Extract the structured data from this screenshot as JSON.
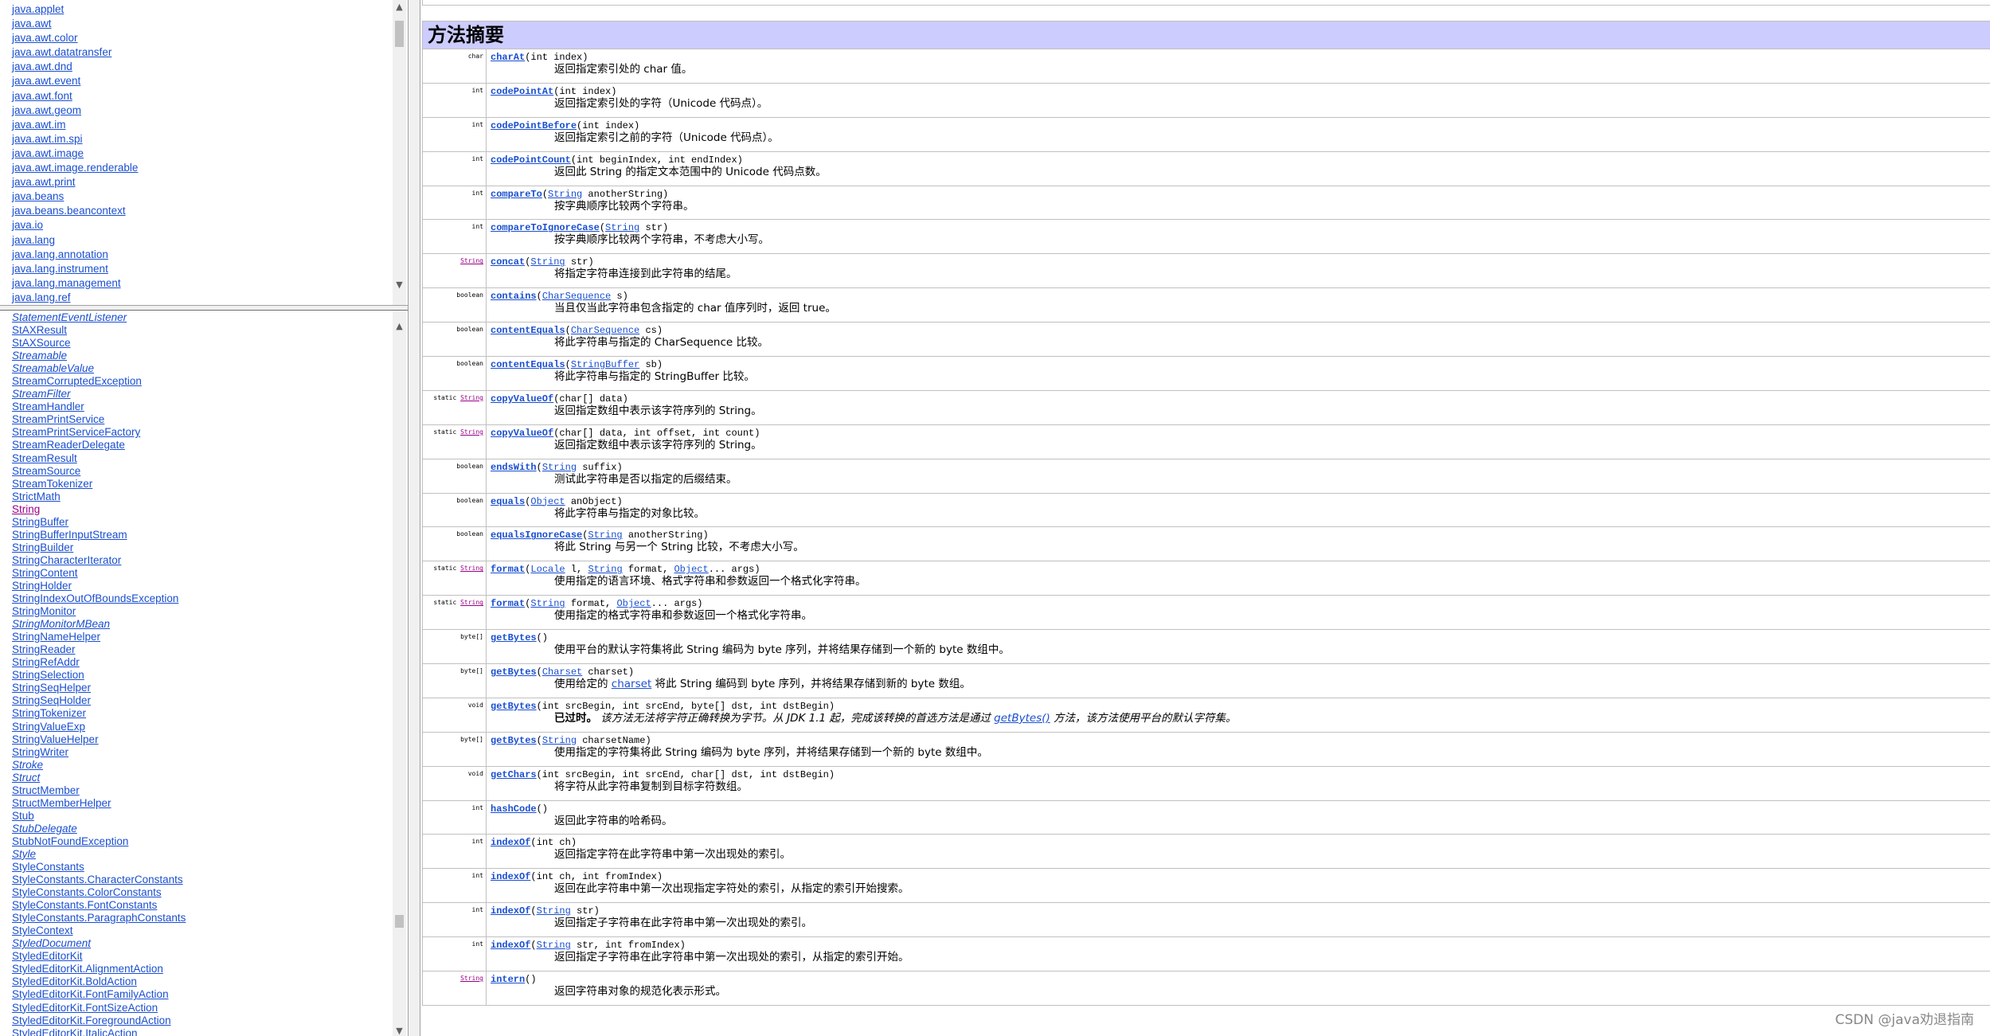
{
  "packages": [
    "java.applet",
    "java.awt",
    "java.awt.color",
    "java.awt.datatransfer",
    "java.awt.dnd",
    "java.awt.event",
    "java.awt.font",
    "java.awt.geom",
    "java.awt.im",
    "java.awt.im.spi",
    "java.awt.image",
    "java.awt.image.renderable",
    "java.awt.print",
    "java.beans",
    "java.beans.beancontext",
    "java.io",
    "java.lang",
    "java.lang.annotation",
    "java.lang.instrument",
    "java.lang.management",
    "java.lang.ref"
  ],
  "classes": [
    {
      "name": "StatementEventListener",
      "interface": true
    },
    {
      "name": "StAXResult"
    },
    {
      "name": "StAXSource"
    },
    {
      "name": "Streamable",
      "interface": true
    },
    {
      "name": "StreamableValue",
      "interface": true
    },
    {
      "name": "StreamCorruptedException"
    },
    {
      "name": "StreamFilter",
      "interface": true
    },
    {
      "name": "StreamHandler"
    },
    {
      "name": "StreamPrintService"
    },
    {
      "name": "StreamPrintServiceFactory"
    },
    {
      "name": "StreamReaderDelegate"
    },
    {
      "name": "StreamResult"
    },
    {
      "name": "StreamSource"
    },
    {
      "name": "StreamTokenizer"
    },
    {
      "name": "StrictMath"
    },
    {
      "name": "String",
      "current": true
    },
    {
      "name": "StringBuffer"
    },
    {
      "name": "StringBufferInputStream"
    },
    {
      "name": "StringBuilder"
    },
    {
      "name": "StringCharacterIterator"
    },
    {
      "name": "StringContent"
    },
    {
      "name": "StringHolder"
    },
    {
      "name": "StringIndexOutOfBoundsException"
    },
    {
      "name": "StringMonitor"
    },
    {
      "name": "StringMonitorMBean",
      "interface": true
    },
    {
      "name": "StringNameHelper"
    },
    {
      "name": "StringReader"
    },
    {
      "name": "StringRefAddr"
    },
    {
      "name": "StringSelection"
    },
    {
      "name": "StringSeqHelper"
    },
    {
      "name": "StringSeqHolder"
    },
    {
      "name": "StringTokenizer"
    },
    {
      "name": "StringValueExp"
    },
    {
      "name": "StringValueHelper"
    },
    {
      "name": "StringWriter"
    },
    {
      "name": "Stroke",
      "interface": true
    },
    {
      "name": "Struct",
      "interface": true
    },
    {
      "name": "StructMember"
    },
    {
      "name": "StructMemberHelper"
    },
    {
      "name": "Stub"
    },
    {
      "name": "StubDelegate",
      "interface": true
    },
    {
      "name": "StubNotFoundException"
    },
    {
      "name": "Style",
      "interface": true
    },
    {
      "name": "StyleConstants"
    },
    {
      "name": "StyleConstants.CharacterConstants"
    },
    {
      "name": "StyleConstants.ColorConstants"
    },
    {
      "name": "StyleConstants.FontConstants"
    },
    {
      "name": "StyleConstants.ParagraphConstants"
    },
    {
      "name": "StyleContext"
    },
    {
      "name": "StyledDocument",
      "interface": true
    },
    {
      "name": "StyledEditorKit"
    },
    {
      "name": "StyledEditorKit.AlignmentAction"
    },
    {
      "name": "StyledEditorKit.BoldAction"
    },
    {
      "name": "StyledEditorKit.FontFamilyAction"
    },
    {
      "name": "StyledEditorKit.FontSizeAction"
    },
    {
      "name": "StyledEditorKit.ForegroundAction"
    },
    {
      "name": "StyledEditorKit.ItalicAction"
    }
  ],
  "summary_title": "方法摘要",
  "methods": [
    {
      "mod": [
        {
          "t": "char"
        }
      ],
      "sig": [
        {
          "m": "charAt"
        },
        {
          "t": "(int index)"
        }
      ],
      "desc": [
        {
          "t": "返回指定索引处的 char 值。"
        }
      ]
    },
    {
      "mod": [
        {
          "t": "int"
        }
      ],
      "sig": [
        {
          "m": "codePointAt"
        },
        {
          "t": "(int index)"
        }
      ],
      "desc": [
        {
          "t": "返回指定索引处的字符（Unicode 代码点）。"
        }
      ]
    },
    {
      "mod": [
        {
          "t": "int"
        }
      ],
      "sig": [
        {
          "m": "codePointBefore"
        },
        {
          "t": "(int index)"
        }
      ],
      "desc": [
        {
          "t": "返回指定索引之前的字符（Unicode 代码点）。"
        }
      ]
    },
    {
      "mod": [
        {
          "t": "int"
        }
      ],
      "sig": [
        {
          "m": "codePointCount"
        },
        {
          "t": "(int beginIndex, int endIndex)"
        }
      ],
      "desc": [
        {
          "t": "返回此 String 的指定文本范围中的 Unicode 代码点数。"
        }
      ]
    },
    {
      "mod": [
        {
          "t": "int"
        }
      ],
      "sig": [
        {
          "m": "compareTo"
        },
        {
          "t": "("
        },
        {
          "l": "String"
        },
        {
          "t": " anotherString)"
        }
      ],
      "desc": [
        {
          "t": "按字典顺序比较两个字符串。"
        }
      ]
    },
    {
      "mod": [
        {
          "t": "int"
        }
      ],
      "sig": [
        {
          "m": "compareToIgnoreCase"
        },
        {
          "t": "("
        },
        {
          "l": "String"
        },
        {
          "t": " str)"
        }
      ],
      "desc": [
        {
          "t": "按字典顺序比较两个字符串，不考虑大小写。"
        }
      ]
    },
    {
      "mod": [
        {
          "l": "String"
        }
      ],
      "sig": [
        {
          "m": "concat"
        },
        {
          "t": "("
        },
        {
          "l": "String"
        },
        {
          "t": " str)"
        }
      ],
      "desc": [
        {
          "t": "将指定字符串连接到此字符串的结尾。"
        }
      ]
    },
    {
      "mod": [
        {
          "t": "boolean"
        }
      ],
      "sig": [
        {
          "m": "contains"
        },
        {
          "t": "("
        },
        {
          "l": "CharSequence"
        },
        {
          "t": " s)"
        }
      ],
      "desc": [
        {
          "t": "当且仅当此字符串包含指定的 char 值序列时，返回 true。"
        }
      ]
    },
    {
      "mod": [
        {
          "t": "boolean"
        }
      ],
      "sig": [
        {
          "m": "contentEquals"
        },
        {
          "t": "("
        },
        {
          "l": "CharSequence"
        },
        {
          "t": " cs)"
        }
      ],
      "desc": [
        {
          "t": "将此字符串与指定的 CharSequence 比较。"
        }
      ]
    },
    {
      "mod": [
        {
          "t": "boolean"
        }
      ],
      "sig": [
        {
          "m": "contentEquals"
        },
        {
          "t": "("
        },
        {
          "l": "StringBuffer"
        },
        {
          "t": " sb)"
        }
      ],
      "desc": [
        {
          "t": "将此字符串与指定的 StringBuffer 比较。"
        }
      ]
    },
    {
      "mod": [
        {
          "t": "static "
        },
        {
          "l": "String"
        }
      ],
      "sig": [
        {
          "m": "copyValueOf"
        },
        {
          "t": "(char[] data)"
        }
      ],
      "desc": [
        {
          "t": "返回指定数组中表示该字符序列的 String。"
        }
      ]
    },
    {
      "mod": [
        {
          "t": "static "
        },
        {
          "l": "String"
        }
      ],
      "sig": [
        {
          "m": "copyValueOf"
        },
        {
          "t": "(char[] data, int offset, int count)"
        }
      ],
      "desc": [
        {
          "t": "返回指定数组中表示该字符序列的 String。"
        }
      ]
    },
    {
      "mod": [
        {
          "t": "boolean"
        }
      ],
      "sig": [
        {
          "m": "endsWith"
        },
        {
          "t": "("
        },
        {
          "l": "String"
        },
        {
          "t": " suffix)"
        }
      ],
      "desc": [
        {
          "t": "测试此字符串是否以指定的后缀结束。"
        }
      ]
    },
    {
      "mod": [
        {
          "t": "boolean"
        }
      ],
      "sig": [
        {
          "m": "equals"
        },
        {
          "t": "("
        },
        {
          "l": "Object"
        },
        {
          "t": " anObject)"
        }
      ],
      "desc": [
        {
          "t": "将此字符串与指定的对象比较。"
        }
      ]
    },
    {
      "mod": [
        {
          "t": "boolean"
        }
      ],
      "sig": [
        {
          "m": "equalsIgnoreCase"
        },
        {
          "t": "("
        },
        {
          "l": "String"
        },
        {
          "t": " anotherString)"
        }
      ],
      "desc": [
        {
          "t": "将此 String 与另一个 String 比较，不考虑大小写。"
        }
      ]
    },
    {
      "mod": [
        {
          "t": "static "
        },
        {
          "l": "String"
        }
      ],
      "sig": [
        {
          "m": "format"
        },
        {
          "t": "("
        },
        {
          "l": "Locale"
        },
        {
          "t": " l, "
        },
        {
          "l": "String"
        },
        {
          "t": " format, "
        },
        {
          "l": "Object"
        },
        {
          "t": "... args)"
        }
      ],
      "desc": [
        {
          "t": "使用指定的语言环境、格式字符串和参数返回一个格式化字符串。"
        }
      ]
    },
    {
      "mod": [
        {
          "t": "static "
        },
        {
          "l": "String"
        }
      ],
      "sig": [
        {
          "m": "format"
        },
        {
          "t": "("
        },
        {
          "l": "String"
        },
        {
          "t": " format, "
        },
        {
          "l": "Object"
        },
        {
          "t": "... args)"
        }
      ],
      "desc": [
        {
          "t": "使用指定的格式字符串和参数返回一个格式化字符串。"
        }
      ]
    },
    {
      "mod": [
        {
          "t": "byte[]"
        }
      ],
      "sig": [
        {
          "m": "getBytes"
        },
        {
          "t": "()"
        }
      ],
      "desc": [
        {
          "t": "使用平台的默认字符集将此 String 编码为 byte 序列，并将结果存储到一个新的 byte 数组中。"
        }
      ]
    },
    {
      "mod": [
        {
          "t": "byte[]"
        }
      ],
      "sig": [
        {
          "m": "getBytes"
        },
        {
          "t": "("
        },
        {
          "l": "Charset"
        },
        {
          "t": " charset)"
        }
      ],
      "desc": [
        {
          "t": "使用给定的 "
        },
        {
          "l": "charset"
        },
        {
          "t": " 将此 String 编码到 byte 序列，并将结果存储到新的 byte 数组。"
        }
      ]
    },
    {
      "mod": [
        {
          "t": "void"
        }
      ],
      "sig": [
        {
          "m": "getBytes"
        },
        {
          "t": "(int srcBegin, int srcEnd, byte[] dst, int dstBegin)"
        }
      ],
      "desc": [
        {
          "b": "已过时。"
        },
        {
          "i": " 该方法无法将字符正确转换为字节。从 JDK 1.1 起，完成该转换的首选方法是通过 "
        },
        {
          "li": "getBytes()"
        },
        {
          "i": " 方法，该方法使用平台的默认字符集。"
        }
      ]
    },
    {
      "mod": [
        {
          "t": "byte[]"
        }
      ],
      "sig": [
        {
          "m": "getBytes"
        },
        {
          "t": "("
        },
        {
          "l": "String"
        },
        {
          "t": " charsetName)"
        }
      ],
      "desc": [
        {
          "t": "使用指定的字符集将此 String 编码为 byte 序列，并将结果存储到一个新的 byte 数组中。"
        }
      ]
    },
    {
      "mod": [
        {
          "t": "void"
        }
      ],
      "sig": [
        {
          "m": "getChars"
        },
        {
          "t": "(int srcBegin, int srcEnd, char[] dst, int dstBegin)"
        }
      ],
      "desc": [
        {
          "t": "将字符从此字符串复制到目标字符数组。"
        }
      ]
    },
    {
      "mod": [
        {
          "t": "int"
        }
      ],
      "sig": [
        {
          "m": "hashCode"
        },
        {
          "t": "()"
        }
      ],
      "desc": [
        {
          "t": "返回此字符串的哈希码。"
        }
      ]
    },
    {
      "mod": [
        {
          "t": "int"
        }
      ],
      "sig": [
        {
          "m": "indexOf"
        },
        {
          "t": "(int ch)"
        }
      ],
      "desc": [
        {
          "t": "返回指定字符在此字符串中第一次出现处的索引。"
        }
      ]
    },
    {
      "mod": [
        {
          "t": "int"
        }
      ],
      "sig": [
        {
          "m": "indexOf"
        },
        {
          "t": "(int ch, int fromIndex)"
        }
      ],
      "desc": [
        {
          "t": "返回在此字符串中第一次出现指定字符处的索引，从指定的索引开始搜索。"
        }
      ]
    },
    {
      "mod": [
        {
          "t": "int"
        }
      ],
      "sig": [
        {
          "m": "indexOf"
        },
        {
          "t": "("
        },
        {
          "l": "String"
        },
        {
          "t": " str)"
        }
      ],
      "desc": [
        {
          "t": "返回指定子字符串在此字符串中第一次出现处的索引。"
        }
      ]
    },
    {
      "mod": [
        {
          "t": "int"
        }
      ],
      "sig": [
        {
          "m": "indexOf"
        },
        {
          "t": "("
        },
        {
          "l": "String"
        },
        {
          "t": " str, int fromIndex)"
        }
      ],
      "desc": [
        {
          "t": "返回指定子字符串在此字符串中第一次出现处的索引，从指定的索引开始。"
        }
      ]
    },
    {
      "mod": [
        {
          "l": "String"
        }
      ],
      "sig": [
        {
          "m": "intern"
        },
        {
          "t": "()"
        }
      ],
      "desc": [
        {
          "t": "返回字符串对象的规范化表示形式。"
        }
      ]
    }
  ],
  "watermark": "CSDN @java劝退指南"
}
